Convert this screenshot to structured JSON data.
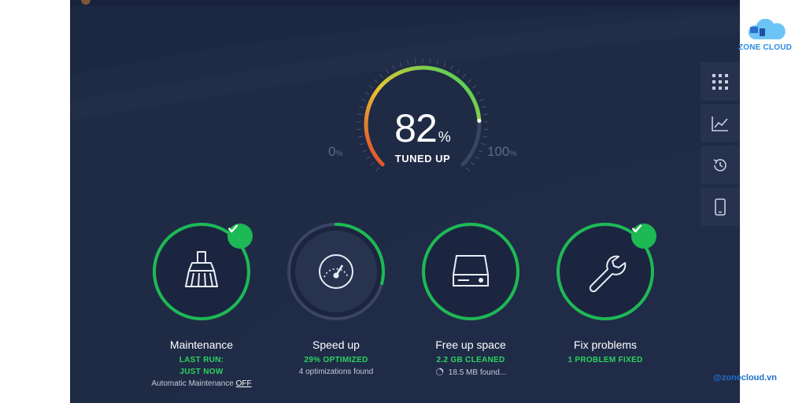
{
  "gauge": {
    "value": "82",
    "unit": "%",
    "status": "TUNED UP",
    "min_label": "0",
    "max_label": "100",
    "end_unit": "%",
    "progress": 0.82
  },
  "rail": {
    "items": [
      {
        "icon": "grid-icon"
      },
      {
        "icon": "chart-icon"
      },
      {
        "icon": "history-icon"
      },
      {
        "icon": "phone-icon"
      }
    ]
  },
  "tiles": [
    {
      "title": "Maintenance",
      "line1": "LAST RUN:",
      "line2": "JUST NOW",
      "note_prefix": "Automatic Maintenance",
      "note_link": "OFF",
      "icon": "broom-icon",
      "progress": 1.0,
      "done": true
    },
    {
      "title": "Speed up",
      "line1": "29% OPTIMIZED",
      "note": "4 optimizations found",
      "icon": "speedometer-icon",
      "progress": 0.29,
      "done": false
    },
    {
      "title": "Free up space",
      "line1": "2.2 GB CLEANED",
      "note": "18.5 MB found...",
      "icon": "hard-drive-icon",
      "progress": 1.0,
      "done": false
    },
    {
      "title": "Fix problems",
      "line1": "1 PROBLEM FIXED",
      "icon": "wrench-icon",
      "progress": 1.0,
      "done": true
    }
  ],
  "brand": {
    "name": "ZONE CLOUD"
  },
  "watermark": {
    "handle": "@zonecloud.vn"
  },
  "colors": {
    "background": "#1f2a45",
    "accent_green": "#1db954",
    "gauge_red": "#e0442b",
    "gauge_yellow": "#e8c531",
    "brand_blue": "#2a8be3"
  }
}
